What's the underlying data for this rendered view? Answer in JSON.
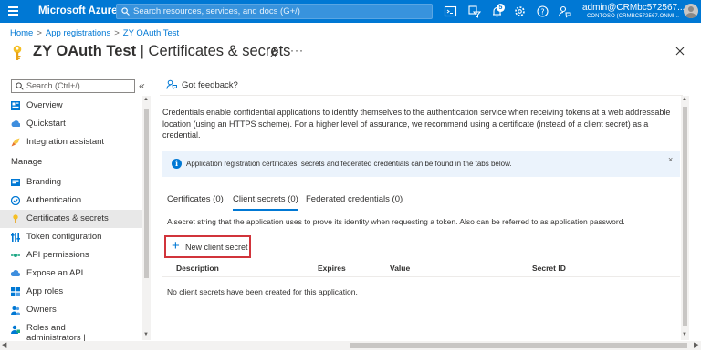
{
  "topbar": {
    "brand": "Microsoft Azure",
    "search_placeholder": "Search resources, services, and docs (G+/)",
    "notifications_count": "5",
    "account_user": "admin@CRMbc572567....",
    "account_tenant": "CONTOSO (CRMBC572567.ONMI...",
    "accent_color": "#0078d4",
    "icons": [
      "cloud-shell-icon",
      "directory-filter-icon",
      "bell-icon",
      "gear-icon",
      "help-icon",
      "feedback-icon"
    ]
  },
  "breadcrumb": [
    "Home",
    "App registrations",
    "ZY OAuth Test"
  ],
  "page": {
    "title_main": "ZY OAuth Test",
    "title_sep": " | ",
    "title_sub": "Certificates & secrets",
    "more": "···"
  },
  "nav": {
    "search_placeholder": "Search (Ctrl+/)",
    "collapse": "«",
    "items": [
      {
        "label": "Overview",
        "icon": "overview-icon"
      },
      {
        "label": "Quickstart",
        "icon": "quickstart-icon"
      },
      {
        "label": "Integration assistant",
        "icon": "rocket-icon"
      }
    ],
    "section": "Manage",
    "manage_items": [
      {
        "label": "Branding",
        "icon": "branding-icon"
      },
      {
        "label": "Authentication",
        "icon": "authentication-icon"
      },
      {
        "label": "Certificates & secrets",
        "icon": "key-icon",
        "active": true
      },
      {
        "label": "Token configuration",
        "icon": "token-icon"
      },
      {
        "label": "API permissions",
        "icon": "api-permissions-icon"
      },
      {
        "label": "Expose an API",
        "icon": "cloud-icon"
      },
      {
        "label": "App roles",
        "icon": "app-roles-icon"
      },
      {
        "label": "Owners",
        "icon": "owners-icon"
      },
      {
        "label": "Roles and administrators | Preview",
        "icon": "roles-icon"
      }
    ]
  },
  "main": {
    "feedback": "Got feedback?",
    "description": "Credentials enable confidential applications to identify themselves to the authentication service when receiving tokens at a web addressable location (using an HTTPS scheme). For a higher level of assurance, we recommend using a certificate (instead of a client secret) as a credential.",
    "info": "Application registration certificates, secrets and federated credentials can be found in the tabs below.",
    "info_close": "×",
    "tabs": [
      {
        "label": "Certificates (0)",
        "active": false
      },
      {
        "label": "Client secrets (0)",
        "active": true
      },
      {
        "label": "Federated credentials (0)",
        "active": false
      }
    ],
    "hint": "A secret string that the application uses to prove its identity when requesting a token. Also can be referred to as application password.",
    "new_button": "New client secret",
    "columns": [
      "Description",
      "Expires",
      "Value",
      "Secret ID"
    ],
    "empty_message": "No client secrets have been created for this application."
  }
}
